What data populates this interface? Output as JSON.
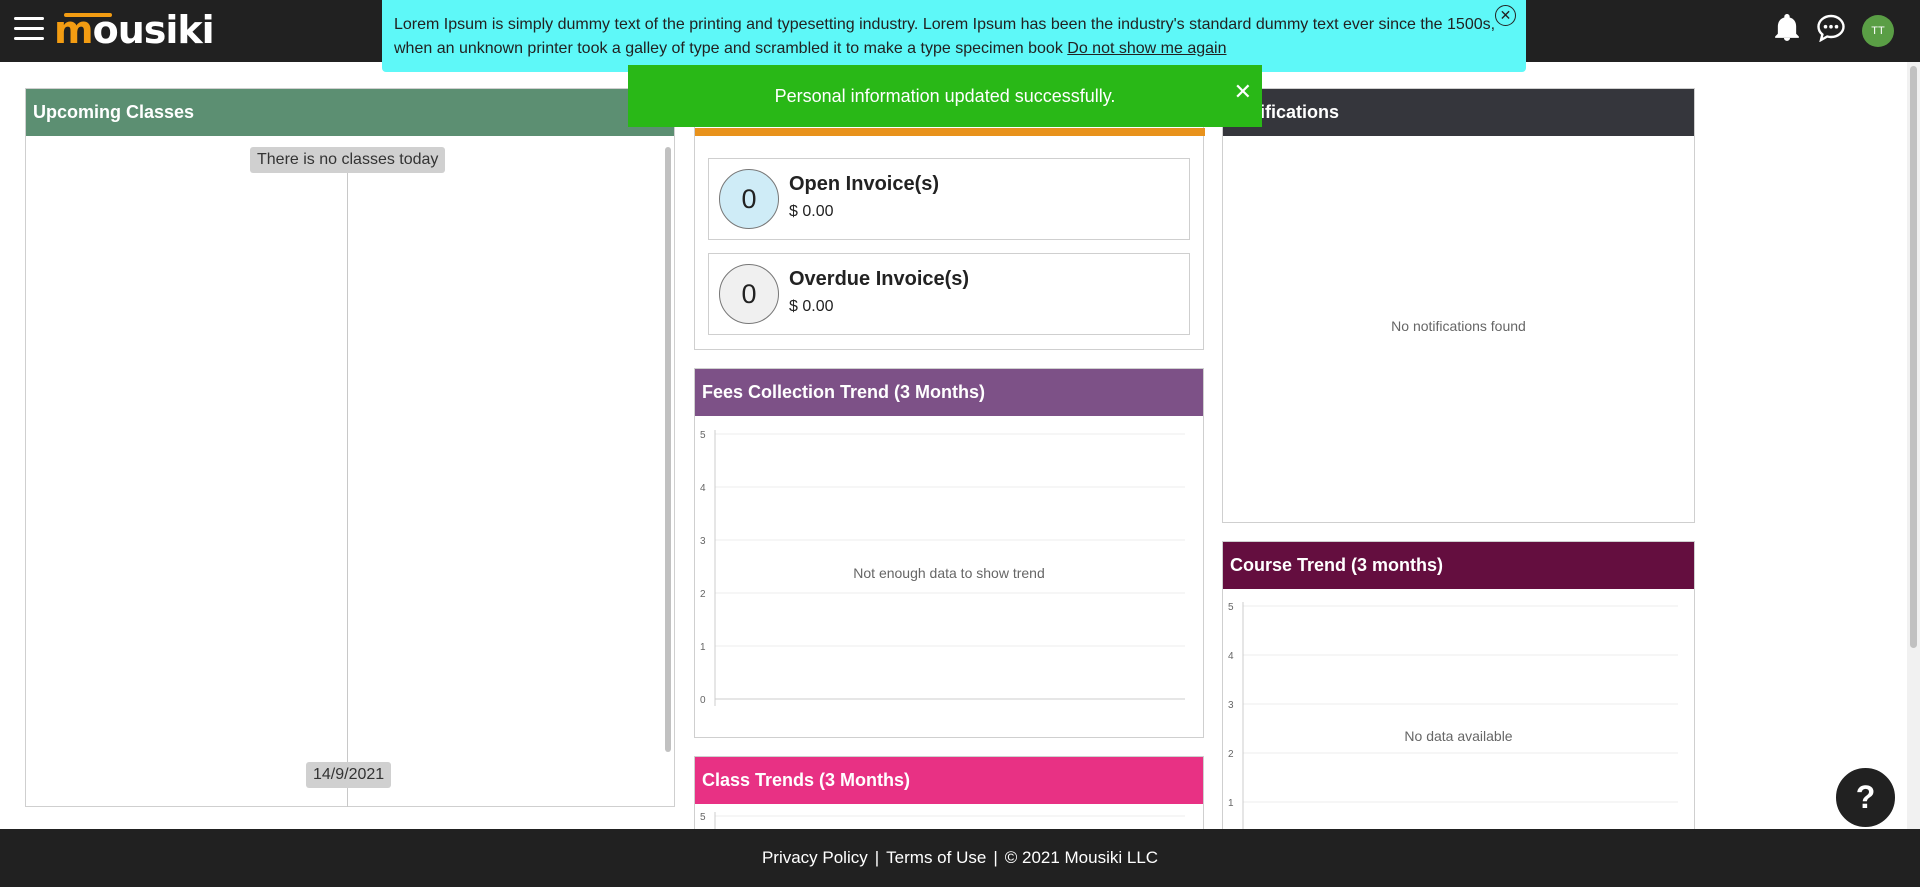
{
  "header": {
    "logo_m": "m",
    "logo_rest": "ousiki",
    "avatar_initials": "TT",
    "icons": [
      "menu-icon",
      "bell-icon",
      "chat-icon"
    ]
  },
  "banner": {
    "text": "Lorem Ipsum is simply dummy text of the printing and typesetting industry. Lorem Ipsum has been the industry's standard dummy text ever since the 1500s, when an unknown printer took a galley of type and scrambled it to make a type specimen book",
    "link": "Do not show me again",
    "close": "✕"
  },
  "toast": {
    "message": "Personal information updated successfully.",
    "close": "✕"
  },
  "upcoming": {
    "title": "Upcoming Classes",
    "empty": "There is no classes today",
    "date": "14/9/2021"
  },
  "invoices": {
    "open": {
      "count": "0",
      "title": "Open Invoice(s)",
      "amount": "$ 0.00"
    },
    "overdue": {
      "count": "0",
      "title": "Overdue Invoice(s)",
      "amount": "$ 0.00"
    }
  },
  "fees": {
    "title": "Fees Collection Trend (3 Months)",
    "empty": "Not enough data to show trend",
    "ticks": [
      "5",
      "4",
      "3",
      "2",
      "1",
      "0"
    ]
  },
  "class_trends": {
    "title": "Class Trends (3 Months)",
    "ticks": [
      "5"
    ]
  },
  "notifications": {
    "title": "Notifications",
    "empty": "No notifications found"
  },
  "course": {
    "title": "Course Trend (3 months)",
    "empty": "No data available",
    "ticks": [
      "5",
      "4",
      "3",
      "2",
      "1"
    ]
  },
  "footer": {
    "privacy": "Privacy Policy",
    "sep": "|",
    "terms": "Terms of Use",
    "copyright": "© 2021 Mousiki LLC"
  },
  "help": "?",
  "colors": {
    "header": "#212121",
    "banner": "#5ef8f8",
    "toast": "#29b817",
    "upcoming": "#5c8f72",
    "invoice_strip": "#e8921c",
    "fees": "#7d5187",
    "class_trends": "#e83184",
    "notifications": "#35363c",
    "course": "#640e3f"
  }
}
